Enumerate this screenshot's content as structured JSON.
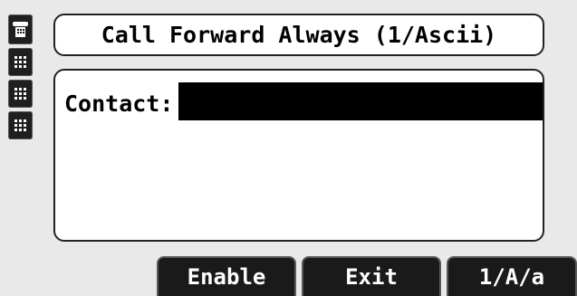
{
  "title": "Call Forward Always (1/Ascii)",
  "contact": {
    "label": "Contact:",
    "value": ""
  },
  "line_keys": [
    {
      "icon": "handset-icon"
    },
    {
      "icon": "keypad-icon"
    },
    {
      "icon": "keypad-icon"
    },
    {
      "icon": "keypad-icon"
    }
  ],
  "softkeys": {
    "enable": "Enable",
    "exit": "Exit",
    "mode": "1/A/a"
  },
  "colors": {
    "background": "#e9e9e9",
    "panel": "#ffffff",
    "softkey": "#1a1a1a",
    "input": "#000000"
  }
}
